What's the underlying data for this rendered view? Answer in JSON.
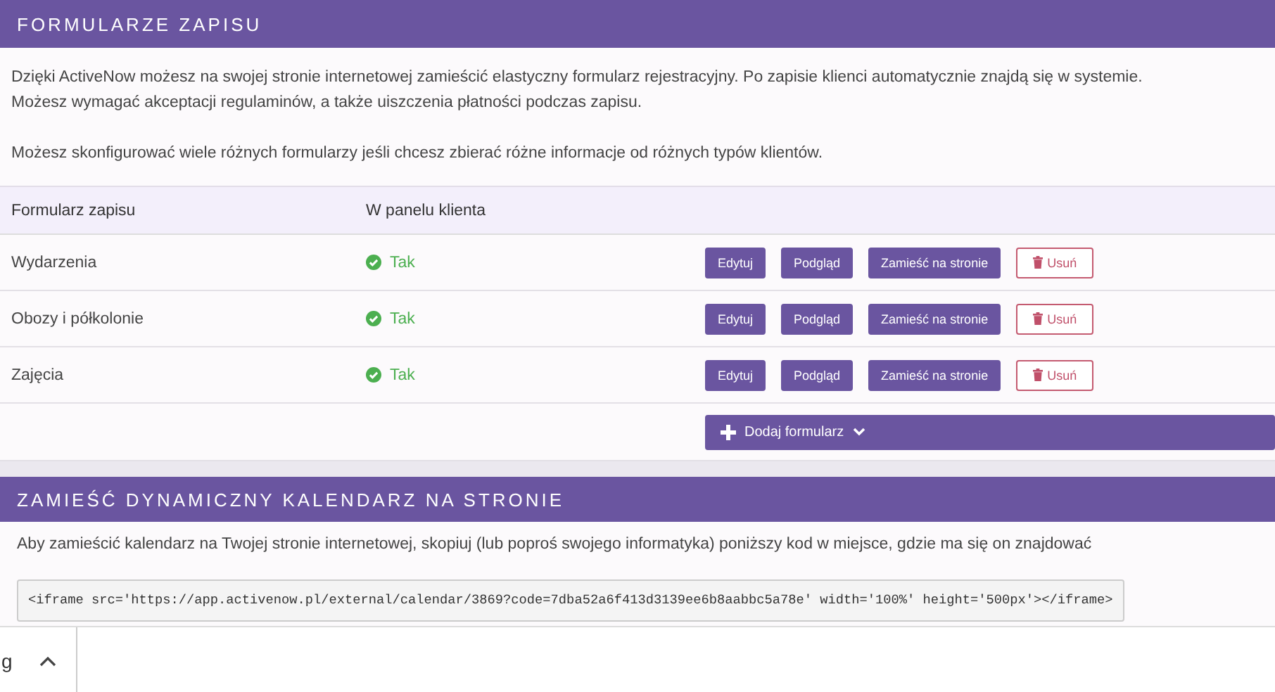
{
  "forms_section": {
    "title": "FORMULARZE ZAPISU",
    "paragraphs": [
      {
        "lines": [
          "Dzięki ActiveNow możesz na swojej stronie internetowej zamieścić elastyczny formularz rejestracyjny. Po zapisie klienci automatycznie znajdą się w systemie.",
          "Możesz wymagać akceptacji regulaminów, a także uiszczenia płatności podczas zapisu."
        ]
      },
      {
        "lines": [
          "Możesz skonfigurować wiele różnych formularzy jeśli chcesz zbierać różne informacje od różnych typów klientów."
        ]
      }
    ],
    "table": {
      "columns": [
        "Formularz zapisu",
        "W panelu klienta"
      ],
      "rows": [
        {
          "name": "Wydarzenia",
          "in_panel": true,
          "in_panel_label": "Tak",
          "actions": [
            {
              "label": "Edytuj",
              "kind": "primary"
            },
            {
              "label": "Podgląd",
              "kind": "primary"
            },
            {
              "label": "Zamieść na stronie",
              "kind": "primary"
            },
            {
              "label": "Usuń",
              "kind": "danger"
            }
          ]
        },
        {
          "name": "Obozy i półkolonie",
          "in_panel": true,
          "in_panel_label": "Tak",
          "actions": [
            {
              "label": "Edytuj",
              "kind": "primary"
            },
            {
              "label": "Podgląd",
              "kind": "primary"
            },
            {
              "label": "Zamieść na stronie",
              "kind": "primary"
            },
            {
              "label": "Usuń",
              "kind": "danger"
            }
          ]
        },
        {
          "name": "Zajęcia",
          "in_panel": true,
          "in_panel_label": "Tak",
          "actions": [
            {
              "label": "Edytuj",
              "kind": "primary"
            },
            {
              "label": "Podgląd",
              "kind": "primary"
            },
            {
              "label": "Zamieść na stronie",
              "kind": "primary"
            },
            {
              "label": "Usuń",
              "kind": "danger"
            }
          ]
        }
      ]
    },
    "add_button": {
      "label": "Dodaj formularz"
    }
  },
  "calendar_section": {
    "title": "ZAMIEŚĆ DYNAMICZNY KALENDARZ NA STRONIE",
    "text": "Aby zamieścić kalendarz na Twojej stronie internetowej, skopiuj (lub poproś swojego informatyka) poniższy kod w miejsce, gdzie ma się on znajdować",
    "code": "<iframe src='https://app.activenow.pl/external/calendar/3869?code=7dba52a6f413d3139ee6b8aabbc5a78e' width='100%' height='500px'></iframe>"
  },
  "download_bar": {
    "text": "g"
  }
}
